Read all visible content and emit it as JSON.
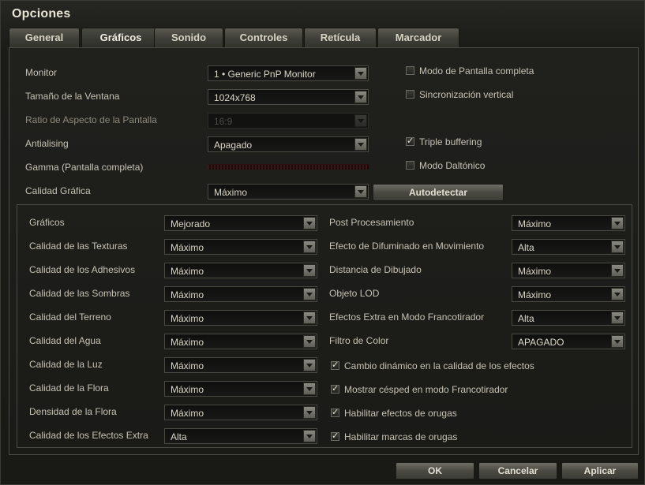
{
  "window": {
    "title": "Opciones"
  },
  "tabs": [
    "General",
    "Gráficos",
    "Sonido",
    "Controles",
    "Retícula",
    "Marcador"
  ],
  "general": {
    "monitor_label": "Monitor",
    "monitor_value": "1 • Generic PnP Monitor",
    "window_size_label": "Tamaño de la Ventana",
    "window_size_value": "1024x768",
    "aspect_label": "Ratio de Aspecto de la Pantalla",
    "aspect_value": "16:9",
    "antialias_label": "Antialising",
    "antialias_value": "Apagado",
    "gamma_label": "Gamma (Pantalla completa)",
    "quality_label": "Calidad Gráfica",
    "quality_value": "Máximo",
    "autodetect": "Autodetectar",
    "checkboxes": [
      {
        "label": "Modo de Pantalla completa",
        "checked": false
      },
      {
        "label": "Sincronización vertical",
        "checked": false
      },
      {
        "label": "Triple buffering",
        "checked": true
      },
      {
        "label": "Modo Daltónico",
        "checked": false
      }
    ]
  },
  "advanced": {
    "left": [
      {
        "label": "Gráficos",
        "value": "Mejorado"
      },
      {
        "label": "Calidad de las Texturas",
        "value": "Máximo"
      },
      {
        "label": "Calidad de los Adhesivos",
        "value": "Máximo"
      },
      {
        "label": "Calidad de las Sombras",
        "value": "Máximo"
      },
      {
        "label": "Calidad del Terreno",
        "value": "Máximo"
      },
      {
        "label": "Calidad del Agua",
        "value": "Máximo"
      },
      {
        "label": "Calidad de la Luz",
        "value": "Máximo"
      },
      {
        "label": "Calidad de la Flora",
        "value": "Máximo"
      },
      {
        "label": "Densidad de la Flora",
        "value": "Máximo"
      },
      {
        "label": "Calidad de los Efectos Extra",
        "value": "Alta"
      }
    ],
    "right": [
      {
        "label": "Post Procesamiento",
        "value": "Máximo"
      },
      {
        "label": "Efecto de Difuminado en Movimiento",
        "value": "Alta"
      },
      {
        "label": "Distancia de Dibujado",
        "value": "Máximo"
      },
      {
        "label": "Objeto LOD",
        "value": "Máximo"
      },
      {
        "label": "Efectos Extra en Modo Francotirador",
        "value": "Alta"
      },
      {
        "label": "Filtro de Color",
        "value": "APAGADO"
      }
    ],
    "checkboxes": [
      {
        "label": "Cambio dinámico en la calidad de los efectos",
        "checked": true
      },
      {
        "label": "Mostrar césped en modo Francotirador",
        "checked": true
      },
      {
        "label": "Habilitar efectos de orugas",
        "checked": true
      },
      {
        "label": "Habilitar marcas de orugas",
        "checked": true
      }
    ]
  },
  "footer": {
    "ok": "OK",
    "cancel": "Cancelar",
    "apply": "Aplicar"
  }
}
